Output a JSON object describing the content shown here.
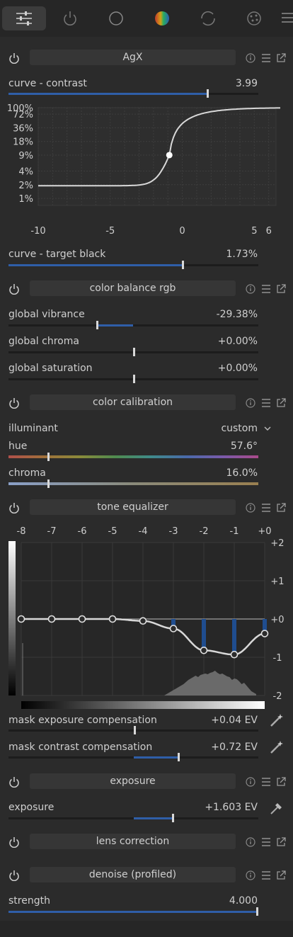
{
  "tabs": [
    {
      "name": "active-modules-tab",
      "icon": "sliders-icon"
    },
    {
      "name": "power-tab",
      "icon": "power-icon"
    },
    {
      "name": "circle-tab",
      "icon": "circle-icon"
    },
    {
      "name": "color-tab",
      "icon": "color-wheel-icon"
    },
    {
      "name": "refresh-tab",
      "icon": "refresh-icon"
    },
    {
      "name": "effects-tab",
      "icon": "film-icon"
    }
  ],
  "agx": {
    "title": "AgX",
    "contrast": {
      "label": "curve - contrast",
      "value": "3.99",
      "fraction": 0.795
    },
    "curve": {
      "y_labels": [
        "100%",
        "72%",
        "36%",
        "18%",
        "9%",
        "4%",
        "2%",
        "1%"
      ],
      "x_labels": [
        "-10",
        "-5",
        "0",
        "5",
        "6"
      ],
      "pivot_ev": -0.9,
      "pivot_pct": 9
    },
    "target_black": {
      "label": "curve - target black",
      "value": "1.73%",
      "fraction": 0.697
    }
  },
  "color_balance": {
    "title": "color balance rgb",
    "vibrance": {
      "label": "global vibrance",
      "value": "-29.38%",
      "fraction": -0.294
    },
    "chroma": {
      "label": "global chroma",
      "value": "+0.00%",
      "fraction": 0.0
    },
    "saturation": {
      "label": "global saturation",
      "value": "+0.00%",
      "fraction": 0.0
    }
  },
  "color_calibration": {
    "title": "color calibration",
    "illuminant": {
      "label": "illuminant",
      "value": "custom"
    },
    "hue": {
      "label": "hue",
      "value": "57.6°",
      "fraction": 0.16
    },
    "chroma": {
      "label": "chroma",
      "value": "16.0%",
      "fraction": 0.16
    }
  },
  "tone_equalizer": {
    "title": "tone equalizer",
    "x_labels": [
      "-8",
      "-7",
      "-6",
      "-5",
      "-4",
      "-3",
      "-2",
      "-1",
      "+0"
    ],
    "y_labels": [
      "+2",
      "+1",
      "+0",
      "-1",
      "-2"
    ],
    "band_values": [
      0.0,
      0.0,
      0.0,
      0.0,
      -0.05,
      -0.25,
      -0.82,
      -0.93,
      -0.38
    ],
    "mask_exposure": {
      "label": "mask exposure compensation",
      "value": "+0.04 EV",
      "fraction": 0.505
    },
    "mask_contrast": {
      "label": "mask contrast compensation",
      "value": "+0.72 EV",
      "fraction": 0.68
    }
  },
  "exposure": {
    "title": "exposure",
    "exposure": {
      "label": "exposure",
      "value": "+1.603 EV",
      "fraction": 0.657
    }
  },
  "lens": {
    "title": "lens correction"
  },
  "denoise": {
    "title": "denoise (profiled)",
    "strength": {
      "label": "strength",
      "value": "4.000",
      "fraction": 1.0
    }
  },
  "colors": {
    "accent": "#2f5ea8",
    "track": "#1c1c1c",
    "header_bg": "#363636",
    "panel": "#2b2b2b"
  }
}
